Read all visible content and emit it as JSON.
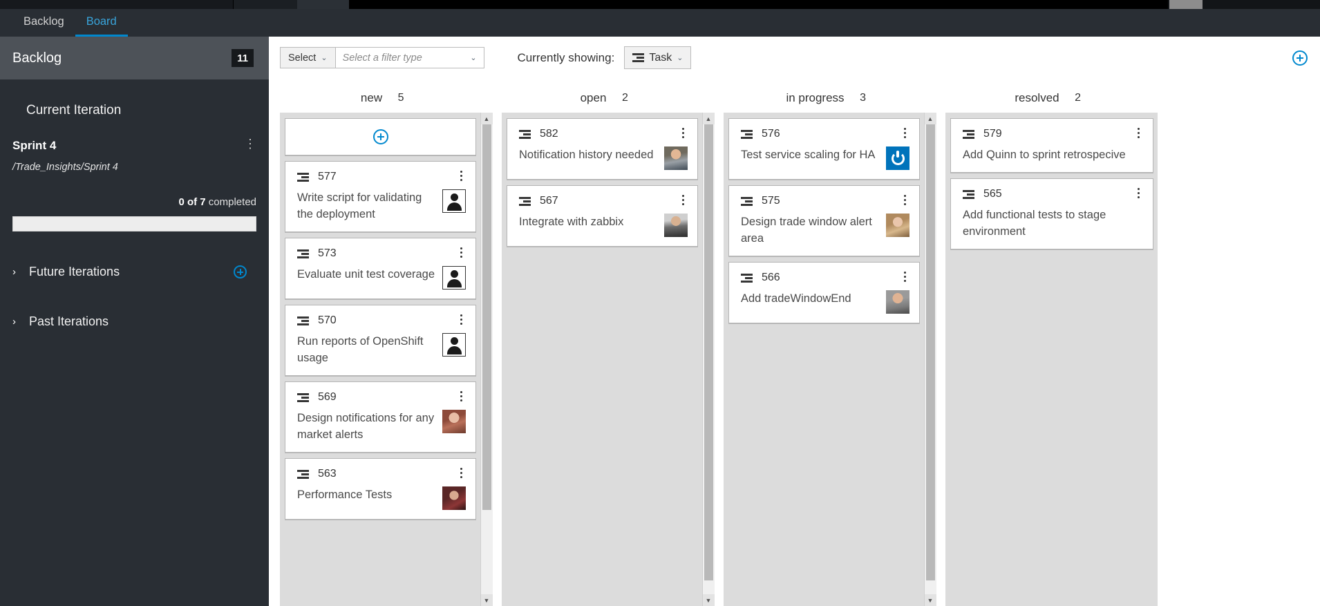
{
  "tabs": [
    {
      "label": "Backlog",
      "active": false
    },
    {
      "label": "Board",
      "active": true
    }
  ],
  "sidebar": {
    "header_title": "Backlog",
    "header_badge": "11",
    "section_title": "Current Iteration",
    "iteration": {
      "name": "Sprint 4",
      "path": "/Trade_Insights/Sprint 4",
      "completed_count": "0 of 7",
      "completed_suffix": " completed",
      "progress_percent": 0,
      "kebab": "⋮"
    },
    "future_iterations": {
      "label": "Future Iterations",
      "chevron": "›"
    },
    "past_iterations": {
      "label": "Past Iterations",
      "chevron": "›"
    }
  },
  "toolbar": {
    "select_label": "Select",
    "filter_placeholder": "Select a filter type",
    "showing_label": "Currently showing:",
    "type_value": "Task",
    "chevron": "⌄"
  },
  "board": {
    "columns": [
      {
        "name": "new",
        "count": "5",
        "has_add_card": true,
        "cards": [
          {
            "id": "577",
            "title": "Write script for validating the deployment",
            "avatar": "placeholder"
          },
          {
            "id": "573",
            "title": "Evaluate unit test coverage",
            "avatar": "placeholder"
          },
          {
            "id": "570",
            "title": "Run reports of OpenShift usage",
            "avatar": "placeholder"
          },
          {
            "id": "569",
            "title": "Design notifications for any market alerts",
            "avatar": "photo-woman-red"
          },
          {
            "id": "563",
            "title": "Performance Tests",
            "avatar": "photo-woman-dark"
          }
        ]
      },
      {
        "name": "open",
        "count": "2",
        "has_add_card": false,
        "cards": [
          {
            "id": "582",
            "title": "Notification history needed",
            "avatar": "photo-man-young"
          },
          {
            "id": "567",
            "title": "Integrate with zabbix",
            "avatar": "photo-man-beard"
          }
        ]
      },
      {
        "name": "in progress",
        "count": "3",
        "has_add_card": false,
        "cards": [
          {
            "id": "576",
            "title": "Test service scaling for HA",
            "avatar": "gitlab"
          },
          {
            "id": "575",
            "title": "Design trade window alert area",
            "avatar": "photo-woman-blonde"
          },
          {
            "id": "566",
            "title": "Add tradeWindowEnd",
            "avatar": "photo-man-smile"
          }
        ]
      },
      {
        "name": "resolved",
        "count": "2",
        "has_add_card": false,
        "cards": [
          {
            "id": "579",
            "title": "Add Quinn to sprint retrospecive",
            "avatar": "none"
          },
          {
            "id": "565",
            "title": "Add functional tests to stage environment",
            "avatar": "none"
          }
        ]
      }
    ]
  },
  "colors": {
    "accent": "#0088ce",
    "sidebar_bg": "#292e34",
    "sidebar_header_bg": "#4d5258",
    "column_bg": "#dcdcdc",
    "gitlab_blue": "#0073bb"
  }
}
